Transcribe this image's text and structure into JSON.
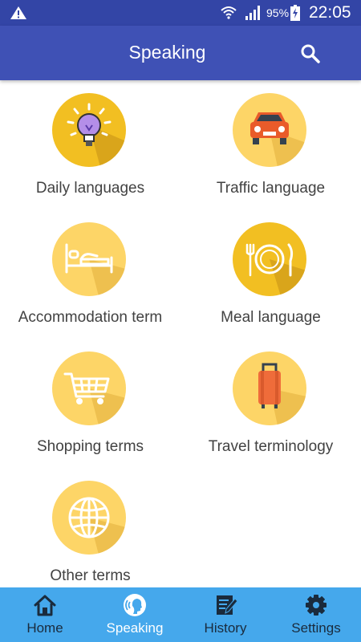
{
  "status_bar": {
    "battery": "95%",
    "time": "22:05"
  },
  "app_bar": {
    "title": "Speaking",
    "search_icon": "search-icon"
  },
  "categories": [
    {
      "label": "Daily languages",
      "icon": "lightbulb-icon"
    },
    {
      "label": "Traffic language",
      "icon": "car-icon"
    },
    {
      "label": "Accommodation term",
      "icon": "bed-icon"
    },
    {
      "label": "Meal language",
      "icon": "plate-fork-knife-icon"
    },
    {
      "label": "Shopping terms",
      "icon": "shopping-cart-icon"
    },
    {
      "label": "Travel terminology",
      "icon": "suitcase-icon"
    },
    {
      "label": "Other terms",
      "icon": "globe-icon"
    }
  ],
  "bottom_nav": [
    {
      "label": "Home",
      "icon": "home-icon",
      "active": false
    },
    {
      "label": "Speaking",
      "icon": "speaking-icon",
      "active": true
    },
    {
      "label": "History",
      "icon": "history-icon",
      "active": false
    },
    {
      "label": "Settings",
      "icon": "gear-icon",
      "active": false
    }
  ],
  "colors": {
    "status_bar": "#3345a6",
    "app_bar": "#3f51b5",
    "bottom_nav": "#45a8ec",
    "circle_yellow": "#fdd567",
    "circle_gold": "#f2bf22",
    "label_text": "#424242"
  }
}
